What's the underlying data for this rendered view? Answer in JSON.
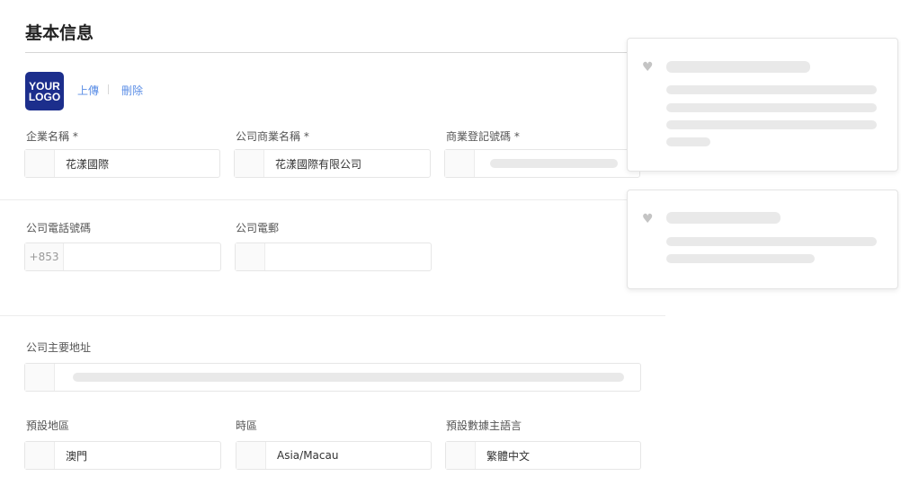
{
  "section": {
    "title": "基本信息"
  },
  "logo": {
    "line1": "YOUR",
    "line2": "LOGO"
  },
  "logo_actions": {
    "upload": "上傳",
    "delete": "刪除"
  },
  "fields": {
    "company_name": {
      "label": "企業名稱 *",
      "value": "花漾國際"
    },
    "trade_name": {
      "label": "公司商業名稱 *",
      "value": "花漾國際有限公司"
    },
    "registration_number": {
      "label": "商業登記號碼 *",
      "value": ""
    },
    "phone": {
      "label": "公司電話號碼",
      "prefix": "+853",
      "value": ""
    },
    "email": {
      "label": "公司電郵",
      "value": ""
    },
    "address": {
      "label": "公司主要地址",
      "value": ""
    },
    "region": {
      "label": "預設地區",
      "value": "澳門"
    },
    "timezone": {
      "label": "時區",
      "value": "Asia/Macau"
    },
    "language": {
      "label": "預設數據主語言",
      "value": "繁體中文"
    }
  },
  "side_cards": [
    {
      "icon": "heart-icon"
    },
    {
      "icon": "heart-icon"
    }
  ],
  "colors": {
    "logo_bg": "#1c2e8c",
    "link": "#5b8ee6",
    "skeleton": "#e9e9e9"
  }
}
